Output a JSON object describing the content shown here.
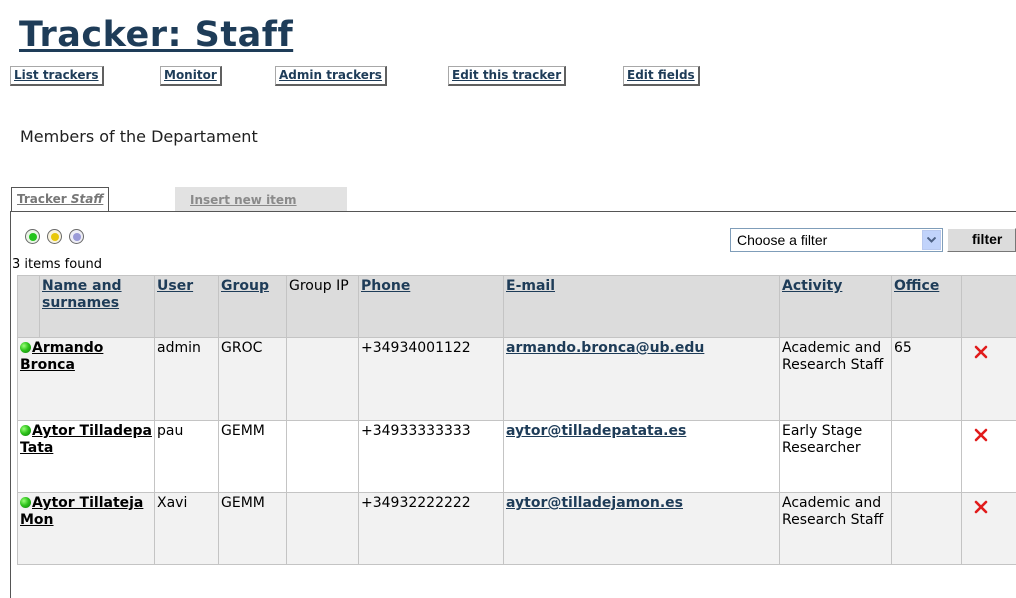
{
  "page": {
    "title": "Tracker: Staff",
    "description": "Members of the Departament"
  },
  "toolbar": {
    "list_trackers": "List trackers",
    "monitor": "Monitor",
    "admin_trackers": "Admin trackers",
    "edit_this_tracker": "Edit this tracker",
    "edit_fields": "Edit fields"
  },
  "tabs": {
    "active_prefix": "Tracker ",
    "active_name": "Staff",
    "insert": "Insert new item"
  },
  "status_filters": {
    "open_color": "#22c41c",
    "pending_color": "#e8c80a",
    "closed_color": "#9a9ad8"
  },
  "filter": {
    "selected": "Choose a filter",
    "button": "filter"
  },
  "result_count": "3 items found",
  "table": {
    "headers": {
      "name": "Name and surnames",
      "user": "User",
      "group": "Group",
      "group_ip": "Group IP",
      "phone": "Phone",
      "email": "E-mail",
      "activity": "Activity",
      "office": "Office"
    },
    "rows": [
      {
        "name": "Armando Bronca",
        "user": "admin",
        "group": "GROC",
        "group_ip": "",
        "phone": "+34934001122",
        "email": "armando.bronca@ub.edu",
        "activity": "Academic and Research Staff",
        "office": "65"
      },
      {
        "name": "Aytor Tilladepa Tata",
        "user": "pau",
        "group": "GEMM",
        "group_ip": "",
        "phone": "+34933333333",
        "email": "aytor@tilladepatata.es",
        "activity": "Early Stage Researcher",
        "office": ""
      },
      {
        "name": "Aytor Tillateja Mon",
        "user": "Xavi",
        "group": "GEMM",
        "group_ip": "",
        "phone": "+34932222222",
        "email": "aytor@tilladejamon.es",
        "activity": "Academic and Research Staff",
        "office": ""
      }
    ]
  },
  "icons": {
    "delete": "delete-x-icon",
    "status": "green-status-icon",
    "dropdown": "chevron-down-icon"
  },
  "colors": {
    "link": "#1e3c58",
    "delete": "#e11b1b",
    "header_bg": "#dcdcdc"
  }
}
